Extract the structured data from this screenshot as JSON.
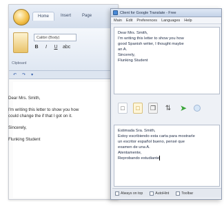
{
  "word": {
    "tabs": [
      "Home",
      "Insert",
      "Page"
    ],
    "font_name": "Calibri (Body)",
    "format_buttons": [
      "B",
      "I",
      "U",
      "abc"
    ],
    "clipboard_label": "Clipboard",
    "ruler_marks": [
      "↶",
      "↷",
      "▾"
    ],
    "document": {
      "greeting": "Dear Mrs. Smith,",
      "body_line1": "I'm writing this letter to show you how",
      "body_line2": "could change the if that I got on it.",
      "closing": "Sincerely,",
      "signature": "Flunking Student"
    }
  },
  "translator": {
    "title": "Client for Google Translate - Free",
    "menu": [
      "Main",
      "Edit",
      "Preferences",
      "Languages",
      "Help"
    ],
    "source_text": {
      "line1": "Dear Mrs. Smith,",
      "line2": "I'm writing this letter to show you how",
      "line3": "good Spanish writer, I thought maybe",
      "line4": "an A.",
      "line5": "Sincerely,",
      "line6": "Flunking Student"
    },
    "target_text": {
      "line1": "Estimada Sra. Smith,",
      "line2": "Estoy escribiendo esta carta para mostrarle",
      "line3": "un escritor español bueno, pensé que",
      "line4": "examen de una A.",
      "line5": "Atentamente,",
      "line6": "Reprobando estudiante"
    },
    "toolbar_icons": [
      "new-document-icon",
      "open-folder-icon",
      "copy-icon",
      "swap-icon",
      "translate-arrow-icon",
      "more-icon"
    ],
    "status": {
      "check1": "Always on top",
      "check2": "AutoHint",
      "check3": "Toolbar"
    }
  }
}
